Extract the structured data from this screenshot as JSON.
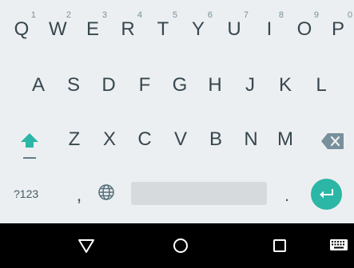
{
  "keyboard": {
    "row1": [
      {
        "letter": "Q",
        "hint": "1"
      },
      {
        "letter": "W",
        "hint": "2"
      },
      {
        "letter": "E",
        "hint": "3"
      },
      {
        "letter": "R",
        "hint": "4"
      },
      {
        "letter": "T",
        "hint": "5"
      },
      {
        "letter": "Y",
        "hint": "6"
      },
      {
        "letter": "U",
        "hint": "7"
      },
      {
        "letter": "I",
        "hint": "8"
      },
      {
        "letter": "O",
        "hint": "9"
      },
      {
        "letter": "P",
        "hint": "0"
      }
    ],
    "row2": [
      "A",
      "S",
      "D",
      "F",
      "G",
      "H",
      "J",
      "K",
      "L"
    ],
    "row3": [
      "Z",
      "X",
      "C",
      "V",
      "B",
      "N",
      "M"
    ],
    "bottom": {
      "symbols_label": "?123",
      "comma": ",",
      "period": "."
    },
    "icons": {
      "shift": "shift-icon",
      "backspace": "backspace-icon",
      "globe": "globe-icon",
      "enter": "enter-icon"
    },
    "colors": {
      "accent": "#2bb6a6",
      "key_text": "#37474f",
      "background": "#eceff1",
      "space_bar": "#d6dadd"
    }
  },
  "navbar": {
    "icons": [
      "back-icon",
      "home-icon",
      "recents-icon",
      "keyboard-switch-icon"
    ],
    "background": "#000000"
  }
}
